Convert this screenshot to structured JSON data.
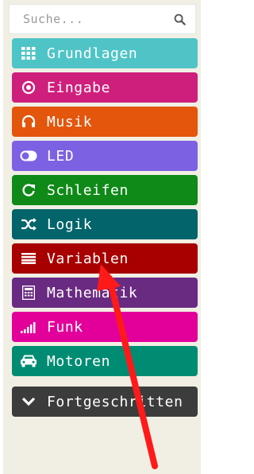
{
  "search": {
    "placeholder": "Suche...",
    "icon": "search-icon"
  },
  "categories": [
    {
      "label": "Grundlagen",
      "color": "#4fc4c6",
      "icon": "grid-icon"
    },
    {
      "label": "Eingabe",
      "color": "#cf1f7c",
      "icon": "target-icon"
    },
    {
      "label": "Musik",
      "color": "#e3560c",
      "icon": "headphones-icon"
    },
    {
      "label": "LED",
      "color": "#7d61e3",
      "icon": "toggle-icon"
    },
    {
      "label": "Schleifen",
      "color": "#0f8a18",
      "icon": "refresh-icon"
    },
    {
      "label": "Logik",
      "color": "#03646b",
      "icon": "shuffle-icon"
    },
    {
      "label": "Variablen",
      "color": "#a80000",
      "icon": "list-icon"
    },
    {
      "label": "Mathematik",
      "color": "#692a82",
      "icon": "calculator-icon"
    },
    {
      "label": "Funk",
      "color": "#e3009a",
      "icon": "signal-icon"
    },
    {
      "label": "Motoren",
      "color": "#008c72",
      "icon": "car-icon"
    }
  ],
  "advanced": {
    "label": "Fortgeschritten",
    "color": "#3c3c3c",
    "icon": "chevron-down-icon"
  },
  "annotation": {
    "color": "#ff1a1a",
    "icon": "red-arrow-icon"
  }
}
